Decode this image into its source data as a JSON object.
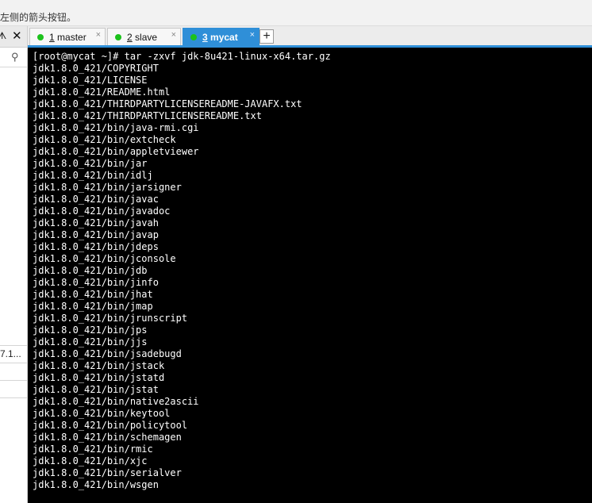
{
  "topbar": {
    "hint": "左侧的箭头按钮。"
  },
  "sidebar": {
    "pin_glyph": "ᗑ",
    "close_glyph": "✕",
    "search_glyph": "⚲",
    "rows": [
      "7.1...",
      "",
      "",
      ""
    ]
  },
  "tabs": [
    {
      "num": "1",
      "name": " master",
      "close": "×",
      "active": false,
      "status_color": "#1cc21c"
    },
    {
      "num": "2",
      "name": " slave",
      "close": "×",
      "active": false,
      "status_color": "#1cc21c"
    },
    {
      "num": "3",
      "name": " mycat",
      "close": "×",
      "active": true,
      "status_color": "#1cc21c"
    }
  ],
  "tab_add_label": "+",
  "terminal": {
    "lines": [
      "[root@mycat ~]# tar -zxvf jdk-8u421-linux-x64.tar.gz",
      "jdk1.8.0_421/COPYRIGHT",
      "jdk1.8.0_421/LICENSE",
      "jdk1.8.0_421/README.html",
      "jdk1.8.0_421/THIRDPARTYLICENSEREADME-JAVAFX.txt",
      "jdk1.8.0_421/THIRDPARTYLICENSEREADME.txt",
      "jdk1.8.0_421/bin/java-rmi.cgi",
      "jdk1.8.0_421/bin/extcheck",
      "jdk1.8.0_421/bin/appletviewer",
      "jdk1.8.0_421/bin/jar",
      "jdk1.8.0_421/bin/idlj",
      "jdk1.8.0_421/bin/jarsigner",
      "jdk1.8.0_421/bin/javac",
      "jdk1.8.0_421/bin/javadoc",
      "jdk1.8.0_421/bin/javah",
      "jdk1.8.0_421/bin/javap",
      "jdk1.8.0_421/bin/jdeps",
      "jdk1.8.0_421/bin/jconsole",
      "jdk1.8.0_421/bin/jdb",
      "jdk1.8.0_421/bin/jinfo",
      "jdk1.8.0_421/bin/jhat",
      "jdk1.8.0_421/bin/jmap",
      "jdk1.8.0_421/bin/jrunscript",
      "jdk1.8.0_421/bin/jps",
      "jdk1.8.0_421/bin/jjs",
      "jdk1.8.0_421/bin/jsadebugd",
      "jdk1.8.0_421/bin/jstack",
      "jdk1.8.0_421/bin/jstatd",
      "jdk1.8.0_421/bin/jstat",
      "jdk1.8.0_421/bin/native2ascii",
      "jdk1.8.0_421/bin/keytool",
      "jdk1.8.0_421/bin/policytool",
      "jdk1.8.0_421/bin/schemagen",
      "jdk1.8.0_421/bin/rmic",
      "jdk1.8.0_421/bin/xjc",
      "jdk1.8.0_421/bin/serialver",
      "jdk1.8.0_421/bin/wsgen"
    ]
  }
}
